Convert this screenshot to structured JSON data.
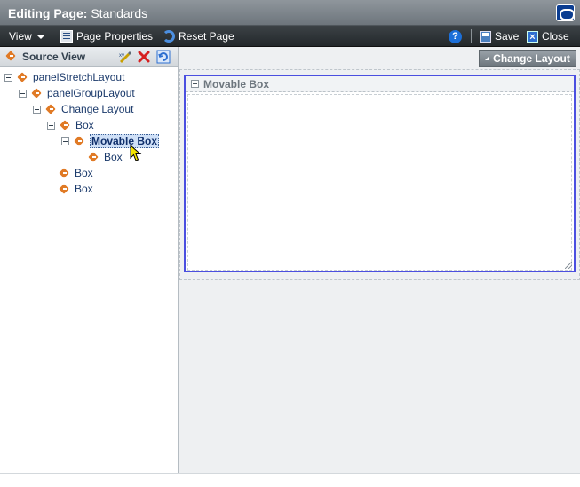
{
  "window": {
    "title_prefix": "Editing Page:",
    "title_page": "Standards",
    "logo_icon": "oracle-logo-icon"
  },
  "toolbar": {
    "view_label": "View",
    "page_properties_label": "Page Properties",
    "reset_page_label": "Reset Page",
    "help_label": "?",
    "save_label": "Save",
    "close_label": "Close"
  },
  "source_view": {
    "title": "Source View",
    "icons": [
      "edit-icon",
      "delete-icon",
      "refresh-icon"
    ],
    "tree": [
      {
        "label": "panelStretchLayout",
        "level": 0,
        "expanded": true
      },
      {
        "label": "panelGroupLayout",
        "level": 1,
        "expanded": true
      },
      {
        "label": "Change Layout",
        "level": 2,
        "expanded": true
      },
      {
        "label": "Box",
        "level": 3,
        "expanded": true
      },
      {
        "label": "Movable Box",
        "level": 4,
        "expanded": true,
        "selected": true
      },
      {
        "label": "Box",
        "level": 5,
        "expanded": null
      },
      {
        "label": "Box",
        "level": 3,
        "expanded": null
      },
      {
        "label": "Box",
        "level": 3,
        "expanded": null
      }
    ]
  },
  "canvas": {
    "change_layout_button": "Change Layout",
    "movable_box_title": "Movable Box"
  },
  "colors": {
    "accent_blue": "#4b4fe0",
    "node_orange": "#e07a25",
    "toolbar_dark": "#23282b"
  }
}
